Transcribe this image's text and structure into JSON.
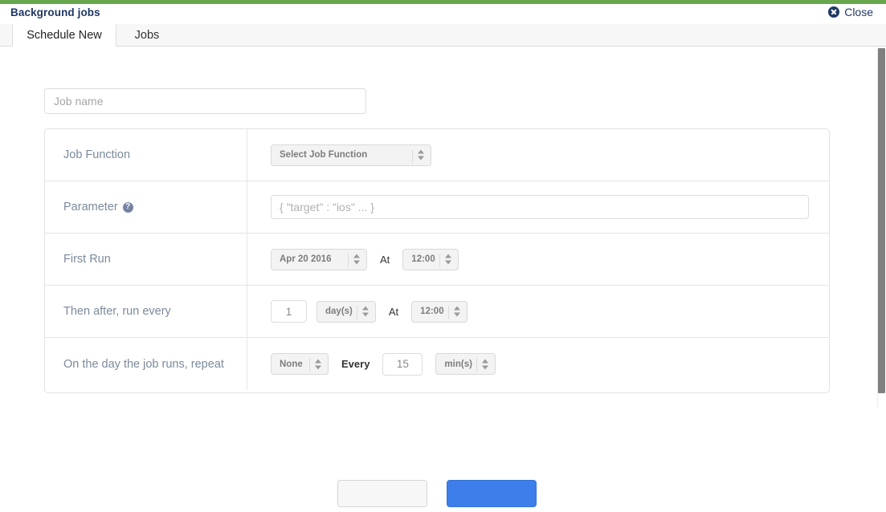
{
  "window": {
    "title": "Background jobs",
    "close_label": "Close",
    "accent_green": "#69a74e",
    "title_color": "#1f3864"
  },
  "tabs": [
    {
      "label": "Schedule New",
      "active": true
    },
    {
      "label": "Jobs",
      "active": false
    }
  ],
  "form": {
    "job_name": {
      "value": "",
      "placeholder": "Job name"
    },
    "rows": [
      {
        "label": "Job Function",
        "help": false,
        "controls": [
          {
            "kind": "select",
            "name": "job-function-select",
            "value": "Select Job Function"
          }
        ]
      },
      {
        "label": "Parameter",
        "help": true,
        "help_glyph": "?",
        "controls": [
          {
            "kind": "text",
            "name": "parameter-input",
            "value": "",
            "placeholder": "{ \"target\" : \"ios\" ... }"
          }
        ]
      },
      {
        "label": "First Run",
        "help": false,
        "controls": [
          {
            "kind": "select",
            "name": "first-run-date-select",
            "value": "Apr 20 2016"
          },
          {
            "kind": "label",
            "name": "at-label-first-run",
            "value": "At"
          },
          {
            "kind": "select",
            "name": "first-run-time-select",
            "value": "12:00"
          }
        ]
      },
      {
        "label": "Then after, run every",
        "help": false,
        "controls": [
          {
            "kind": "input",
            "name": "interval-count-input",
            "value": "1"
          },
          {
            "kind": "select",
            "name": "interval-unit-select",
            "value": "day(s)"
          },
          {
            "kind": "label",
            "name": "at-label-interval",
            "value": "At"
          },
          {
            "kind": "select",
            "name": "interval-time-select",
            "value": "12:00"
          }
        ]
      },
      {
        "label": "On the day the job runs, repeat",
        "help": false,
        "controls": [
          {
            "kind": "select",
            "name": "repeat-mode-select",
            "value": "None"
          },
          {
            "kind": "label",
            "name": "every-label",
            "value": "Every"
          },
          {
            "kind": "input",
            "name": "repeat-count-input",
            "value": "15"
          },
          {
            "kind": "select",
            "name": "repeat-unit-select",
            "value": "min(s)"
          }
        ]
      }
    ]
  },
  "footer": {
    "cancel_label": "",
    "submit_label": ""
  },
  "colors": {
    "label_text": "#7b8a9c",
    "select_bg": "#f3f3f3",
    "primary_button": "#3d7eea",
    "scrollbar_thumb": "#808080"
  }
}
